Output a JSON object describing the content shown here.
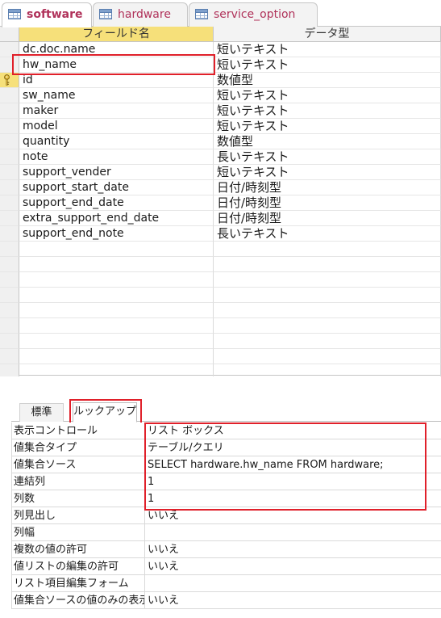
{
  "tabs": [
    {
      "label": "software",
      "active": true
    },
    {
      "label": "hardware",
      "active": false
    },
    {
      "label": "service_option",
      "active": false
    }
  ],
  "grid": {
    "headers": {
      "field_name": "フィールド名",
      "data_type": "データ型"
    },
    "rows": [
      {
        "name": "dc.doc.name",
        "type": "短いテキスト"
      },
      {
        "name": "hw_name",
        "type": "短いテキスト"
      },
      {
        "name": "id",
        "type": "数値型"
      },
      {
        "name": "sw_name",
        "type": "短いテキスト"
      },
      {
        "name": "maker",
        "type": "短いテキスト"
      },
      {
        "name": "model",
        "type": "短いテキスト"
      },
      {
        "name": "quantity",
        "type": "数値型"
      },
      {
        "name": "note",
        "type": "長いテキスト"
      },
      {
        "name": "support_vender",
        "type": "短いテキスト"
      },
      {
        "name": "support_start_date",
        "type": "日付/時刻型"
      },
      {
        "name": "support_end_date",
        "type": "日付/時刻型"
      },
      {
        "name": "extra_support_end_date",
        "type": "日付/時刻型"
      },
      {
        "name": "support_end_note",
        "type": "長いテキスト"
      }
    ]
  },
  "properties": {
    "tabs": {
      "standard": "標準",
      "lookup": "ルックアップ"
    },
    "rows": [
      {
        "label": "表示コントロール",
        "value": "リスト ボックス"
      },
      {
        "label": "値集合タイプ",
        "value": "テーブル/クエリ"
      },
      {
        "label": "値集合ソース",
        "value": "SELECT hardware.hw_name FROM hardware;"
      },
      {
        "label": "連結列",
        "value": "1"
      },
      {
        "label": "列数",
        "value": "1"
      },
      {
        "label": "列見出し",
        "value": "いいえ"
      },
      {
        "label": "列幅",
        "value": ""
      },
      {
        "label": "複数の値の許可",
        "value": "いいえ"
      },
      {
        "label": "値リストの編集の許可",
        "value": "いいえ"
      },
      {
        "label": "リスト項目編集フォーム",
        "value": ""
      },
      {
        "label": "値集合ソースの値のみの表示",
        "value": "いいえ"
      }
    ]
  },
  "colors": {
    "highlight": "#e0202a",
    "header_accent": "#f6e07a",
    "tab_text": "#b0325a"
  },
  "icons": {
    "table": "table-icon",
    "primary_key": "key-icon"
  }
}
